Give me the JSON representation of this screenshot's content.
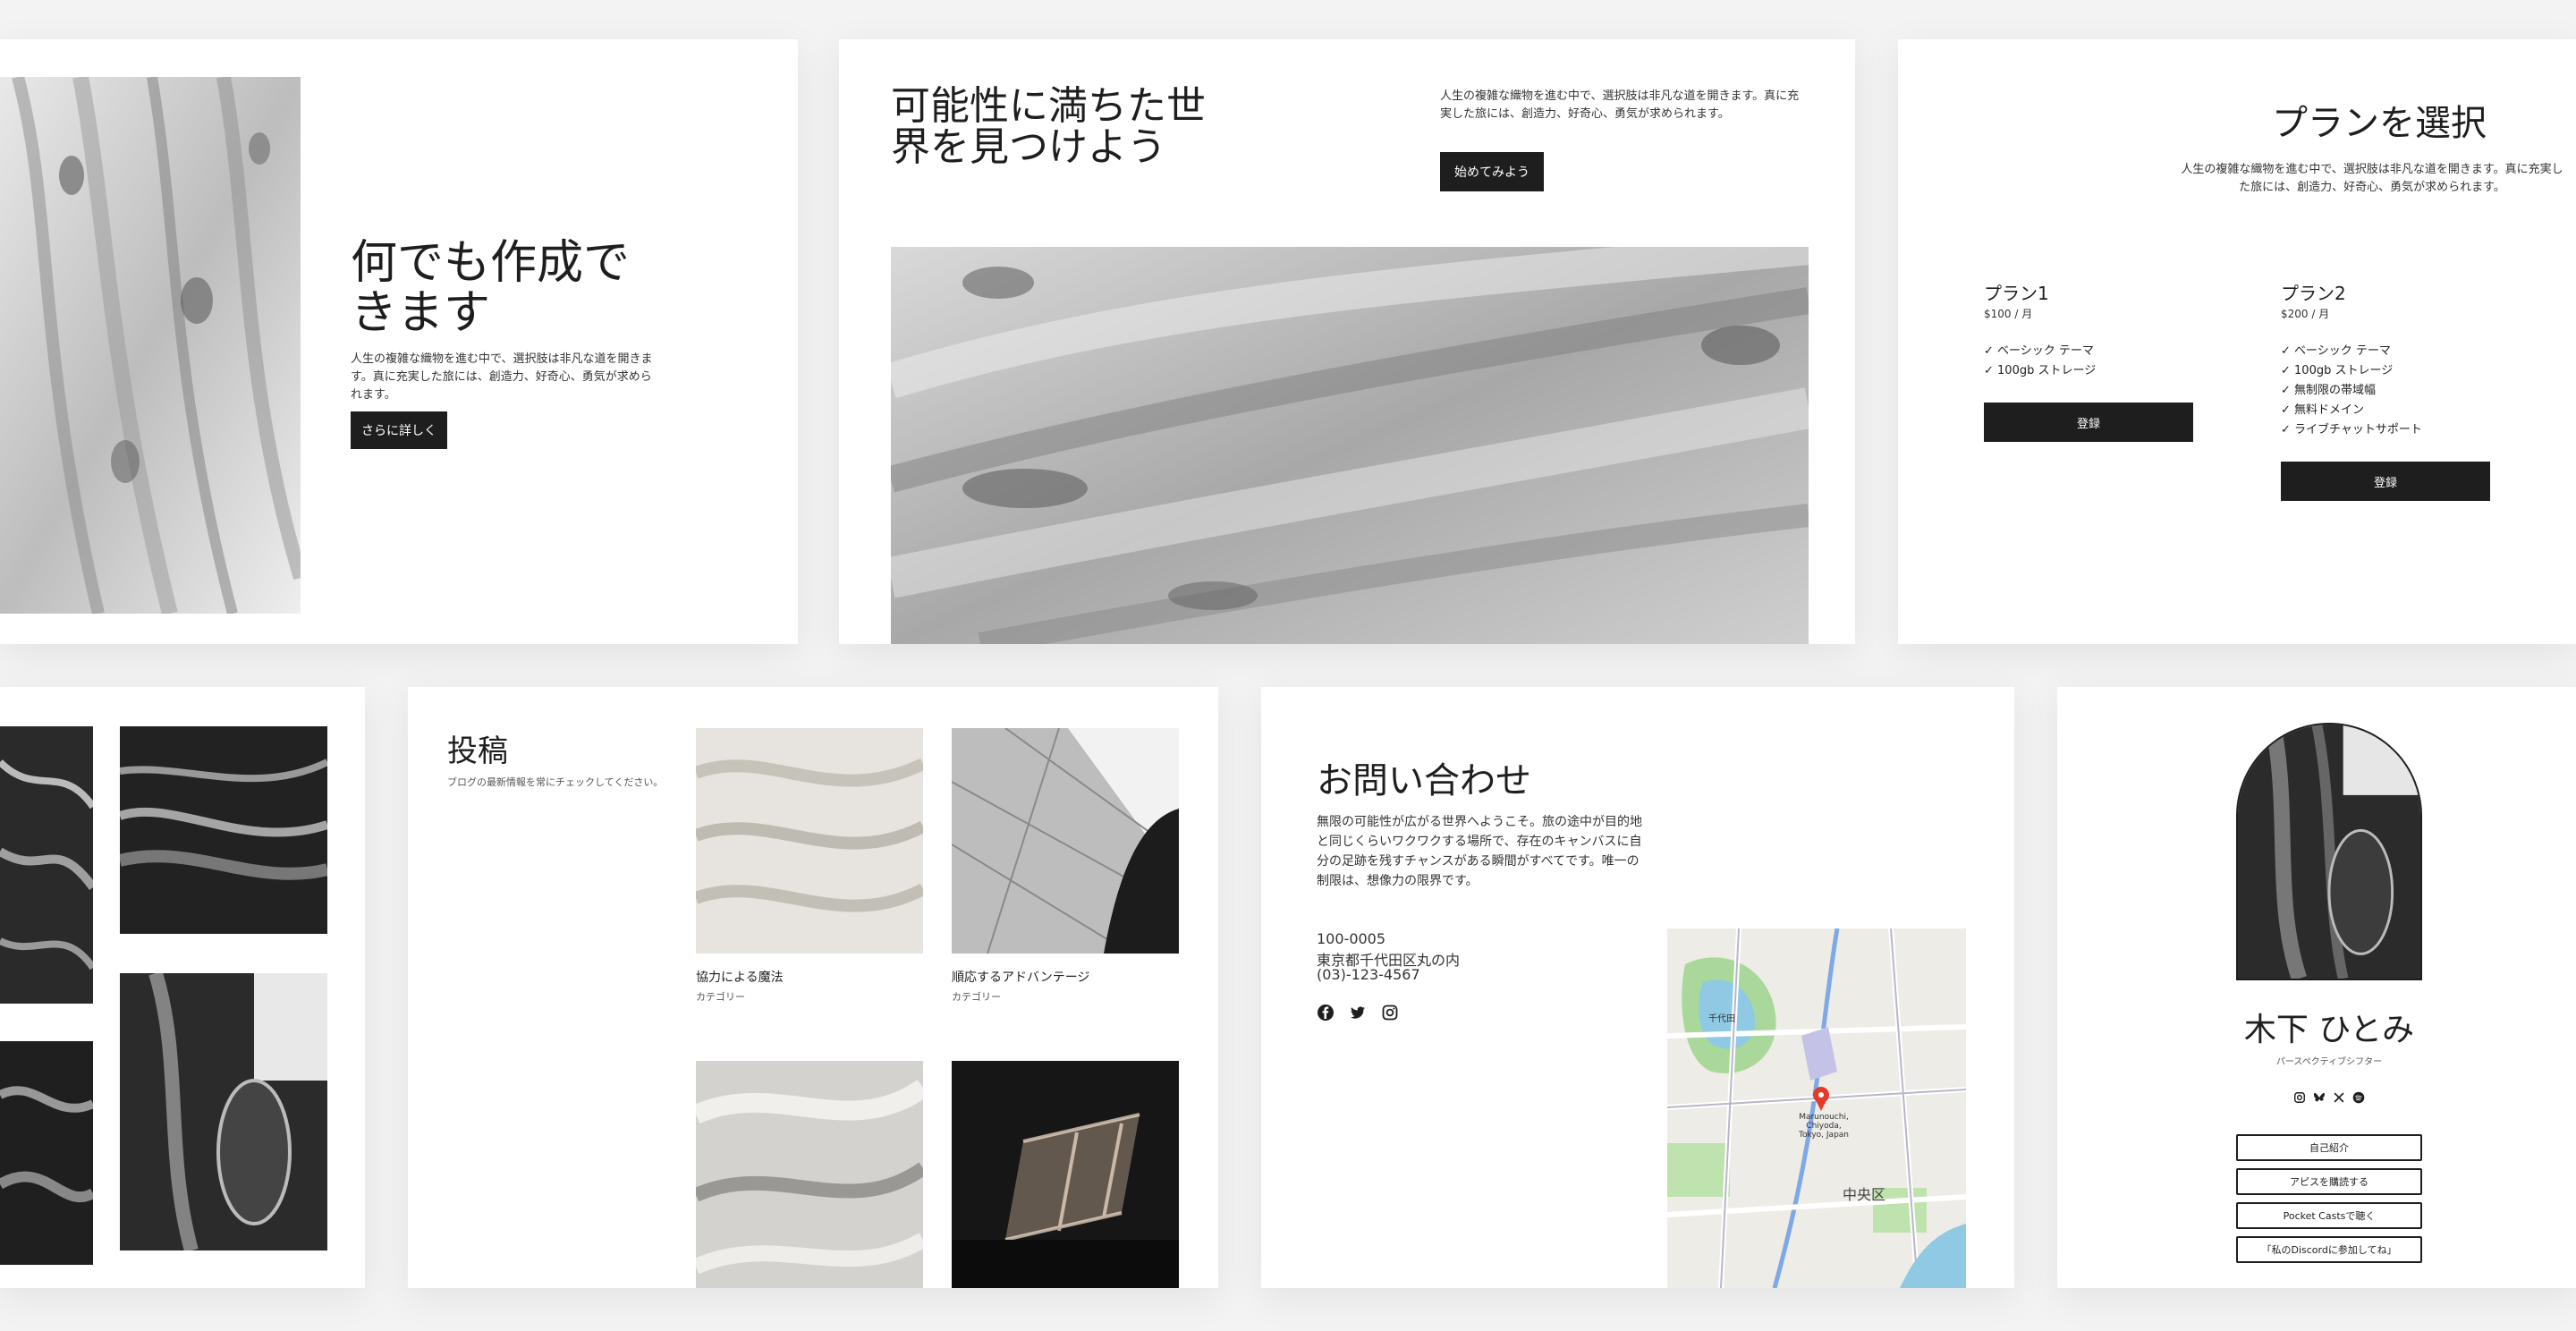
{
  "hero1": {
    "title": "何でも作成できます",
    "body": "人生の複雑な織物を進む中で、選択肢は非凡な道を開きます。真に充実した旅には、創造力、好奇心、勇気が求められます。",
    "button": "さらに詳しく"
  },
  "hero2": {
    "title": "可能性に満ちた世界を見つけよう",
    "body": "人生の複雑な織物を進む中で、選択肢は非凡な道を開きます。真に充実した旅には、創造力、好奇心、勇気が求められます。",
    "button": "始めてみよう"
  },
  "plans": {
    "title": "プランを選択",
    "body": "人生の複雑な織物を進む中で、選択肢は非凡な道を開きます。真に充実した旅には、創造力、好奇心、勇気が求められます。",
    "items": [
      {
        "name": "プラン1",
        "price": "$100 / 月",
        "features": [
          "✓ ベーシック テーマ",
          "✓ 100gb ストレージ"
        ],
        "button": "登録"
      },
      {
        "name": "プラン2",
        "price": "$200 / 月",
        "features": [
          "✓ ベーシック テーマ",
          "✓ 100gb ストレージ",
          "✓ 無制限の帯域幅",
          "✓ 無料ドメイン",
          "✓ ライブチャットサポート"
        ],
        "button": "登録"
      }
    ]
  },
  "posts": {
    "title": "投稿",
    "subtitle": "ブログの最新情報を常にチェックしてください。",
    "items": [
      {
        "title": "協力による魔法",
        "category": "カテゴリー"
      },
      {
        "title": "順応するアドバンテージ",
        "category": "カテゴリー"
      }
    ]
  },
  "contact": {
    "title": "お問い合わせ",
    "body": "無限の可能性が広がる世界へようこそ。旅の途中が目的地と同じくらいワクワクする場所で、存在のキャンバスに自分の足跡を残すチャンスがある瞬間がすべてです。唯一の制限は、想像力の限界です。",
    "postal": "100-0005",
    "address": "東京都千代田区丸の内",
    "phone": "(03)-123-4567",
    "map": {
      "pin_label": "Marunouchi, Chiyoda, Tokyo, Japan",
      "district_label": "中央区",
      "labels": [
        "千代田"
      ]
    }
  },
  "profile": {
    "name": "木下 ひとみ",
    "subtitle": "パースペクティブシフター",
    "links": [
      "自己紹介",
      "アピスを購読する",
      "Pocket Castsで聴く",
      "「私のDiscordに参加してね」"
    ]
  },
  "colors": {
    "accent": "#1e1e1e",
    "background": "#f3f3f3",
    "card": "#ffffff"
  }
}
